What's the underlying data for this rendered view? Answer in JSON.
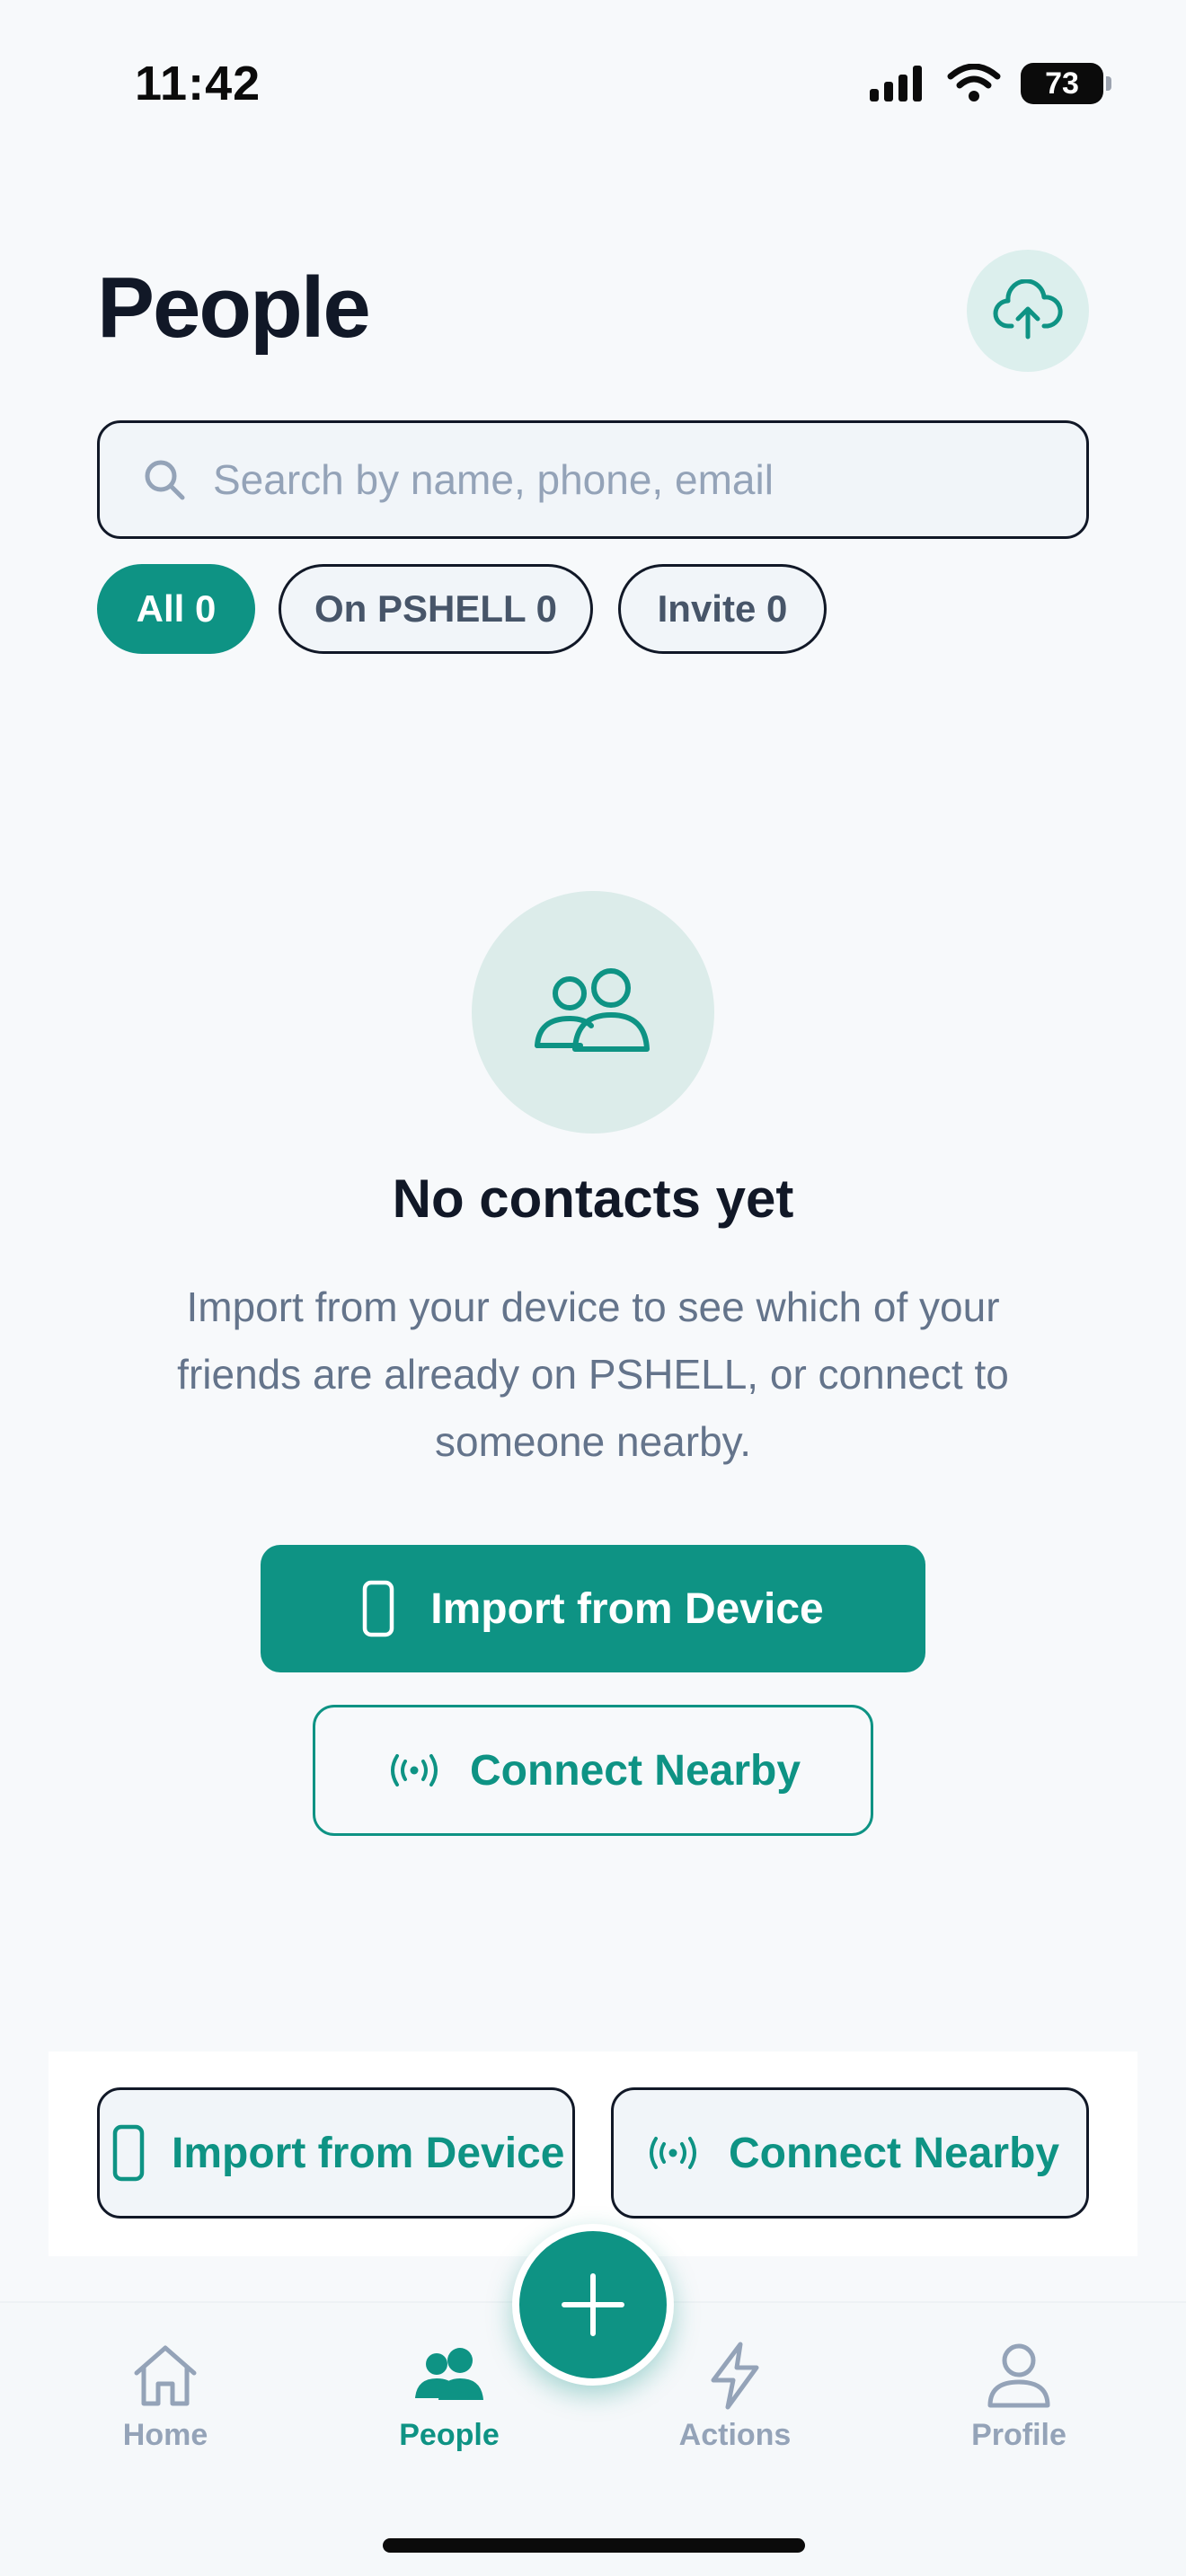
{
  "status_bar": {
    "time": "11:42",
    "battery": "73"
  },
  "header": {
    "title": "People",
    "cloud_icon": "cloud-upload-icon"
  },
  "search": {
    "placeholder": "Search by name, phone, email",
    "value": ""
  },
  "filters": [
    {
      "label": "All 0",
      "active": true
    },
    {
      "label": "On PSHELL 0",
      "active": false
    },
    {
      "label": "Invite 0",
      "active": false
    }
  ],
  "empty_state": {
    "icon": "people-icon",
    "title": "No contacts yet",
    "description": "Import from your device to see which of your friends are already on PSHELL, or connect to someone nearby.",
    "primary_action": "Import from Device",
    "secondary_action": "Connect Nearby"
  },
  "bottom_actions": {
    "import_label": "Import from Device",
    "nearby_label": "Connect Nearby"
  },
  "tab_bar": {
    "tabs": [
      {
        "label": "Home",
        "icon": "home-icon"
      },
      {
        "label": "People",
        "icon": "people-icon",
        "active": true
      },
      {
        "label": "Actions",
        "icon": "lightning-icon"
      },
      {
        "label": "Profile",
        "icon": "profile-icon"
      }
    ],
    "fab_icon": "plus-icon"
  },
  "colors": {
    "accent": "#0e9384",
    "accent_soft": "#dcecea",
    "text_muted": "#64748b"
  }
}
